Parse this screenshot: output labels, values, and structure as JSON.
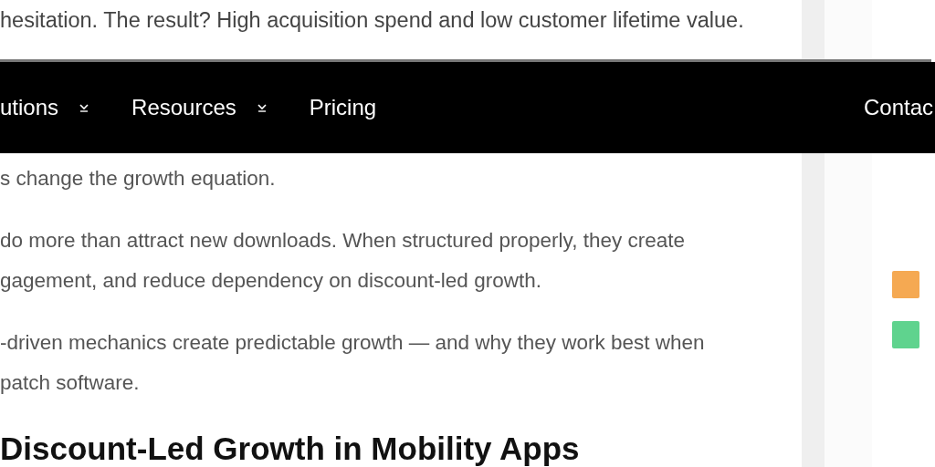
{
  "intro_line": "hesitation. The result? High acquisition spend and low customer lifetime value.",
  "nav": {
    "items": [
      {
        "label": "utions",
        "kind": "dropdown"
      },
      {
        "label": "Resources",
        "kind": "dropdown"
      },
      {
        "label": "Pricing",
        "kind": "link"
      }
    ],
    "contact": "Contac"
  },
  "paragraphs": [
    {
      "lines": [
        "s change the growth equation."
      ]
    },
    {
      "lines": [
        "do more than attract new downloads. When structured properly, they create",
        "gagement, and reduce dependency on discount-led growth."
      ]
    },
    {
      "lines": [
        "-driven mechanics create predictable growth — and why they work best when",
        "patch software."
      ]
    }
  ],
  "heading": "Discount-Led Growth in Mobility Apps",
  "legend": [
    {
      "color": "#f5a952"
    },
    {
      "color": "#5fd38e"
    }
  ]
}
